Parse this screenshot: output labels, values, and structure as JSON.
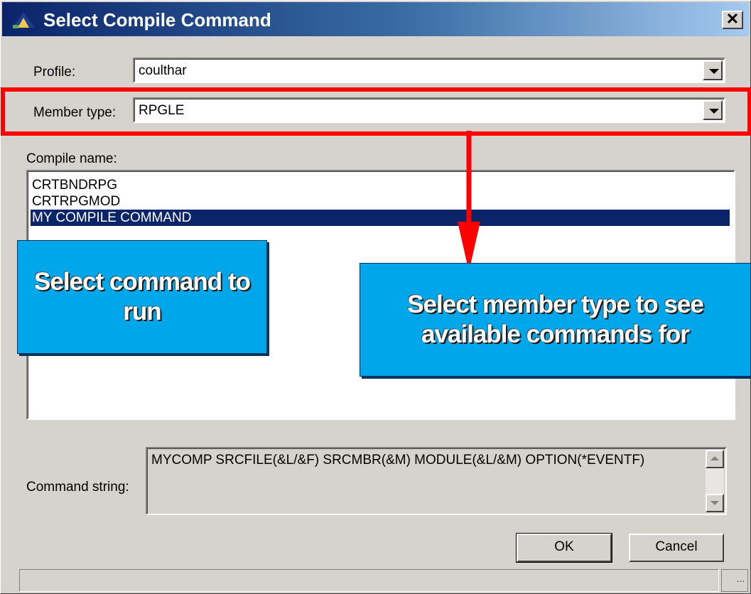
{
  "window": {
    "title": "Select Compile Command",
    "close_glyph": "✕"
  },
  "form": {
    "profile_label": "Profile:",
    "profile_value": "coulthar",
    "member_type_label": "Member type:",
    "member_type_value": "RPGLE",
    "compile_name_label": "Compile name:",
    "compile_items": [
      "CRTBNDRPG",
      "CRTRPGMOD",
      "MY COMPILE COMMAND"
    ],
    "selected_index": 2,
    "command_string_label": "Command string:",
    "command_string_value": "MYCOMP SRCFILE(&L/&F) SRCMBR(&M) MODULE(&L/&M) OPTION(*EVENTF)"
  },
  "buttons": {
    "ok": "OK",
    "cancel": "Cancel"
  },
  "status": {
    "grip": "..."
  },
  "annotations": {
    "left_callout": "Select command to run",
    "right_callout": "Select member type to see available commands for",
    "highlight_color": "#ff0000",
    "callout_color": "#00a6ea"
  }
}
